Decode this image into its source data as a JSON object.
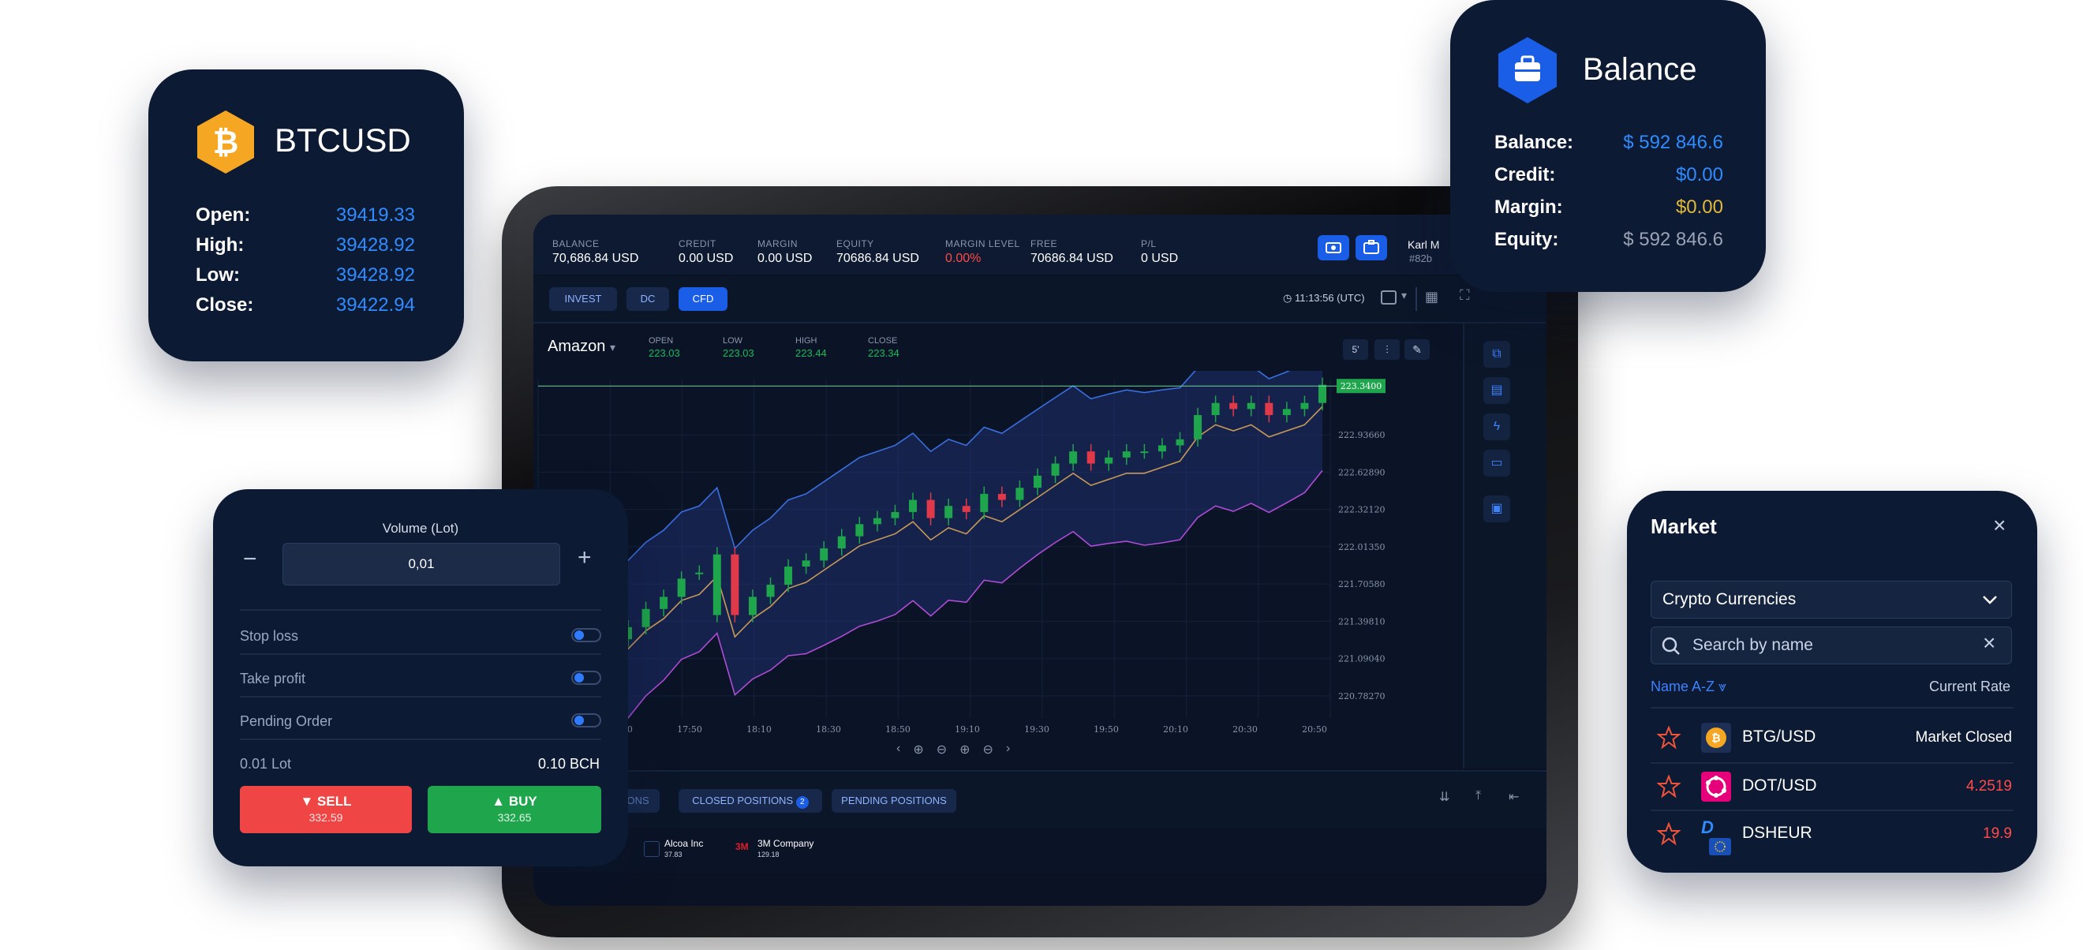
{
  "btc_card": {
    "symbol": "BTCUSD",
    "rows": [
      {
        "label": "Open:",
        "value": "39419.33"
      },
      {
        "label": "High:",
        "value": "39428.92"
      },
      {
        "label": "Low:",
        "value": "39428.92"
      },
      {
        "label": "Close:",
        "value": "39422.94"
      }
    ]
  },
  "balance_card": {
    "title": "Balance",
    "rows": [
      {
        "label": "Balance:",
        "value": "$ 592 846.6",
        "color": "#2f8cff"
      },
      {
        "label": "Credit:",
        "value": "$0.00",
        "color": "#2f8cff"
      },
      {
        "label": "Margin:",
        "value": "$0.00",
        "color": "#e2b93b"
      },
      {
        "label": "Equity:",
        "value": "$ 592 846.6",
        "color": "#9aa3b5"
      }
    ]
  },
  "topbar": {
    "stats": [
      {
        "label": "BALANCE",
        "value": "70,686.84 USD"
      },
      {
        "label": "CREDIT",
        "value": "0.00 USD"
      },
      {
        "label": "MARGIN",
        "value": "0.00 USD"
      },
      {
        "label": "EQUITY",
        "value": "70686.84 USD"
      },
      {
        "label": "MARGIN LEVEL",
        "value": "0.00%"
      },
      {
        "label": "FREE",
        "value": "70686.84 USD"
      },
      {
        "label": "P/L",
        "value": "0 USD"
      }
    ],
    "user_name": "Karl M",
    "user_id": "#82b"
  },
  "mode_tabs": [
    "INVEST",
    "DC",
    "CFD"
  ],
  "clock": "11:13:56 (UTC)",
  "chart_header": {
    "instrument": "Amazon",
    "ohlc": [
      {
        "label": "OPEN",
        "value": "223.03"
      },
      {
        "label": "LOW",
        "value": "223.03"
      },
      {
        "label": "HIGH",
        "value": "223.44"
      },
      {
        "label": "CLOSE",
        "value": "223.34"
      }
    ],
    "timeframe": "5'"
  },
  "chart_data": {
    "type": "candlestick",
    "y_ticks": [
      "222.93660",
      "222.62890",
      "222.32120",
      "222.01350",
      "221.70580",
      "221.39810",
      "221.09040",
      "220.78270"
    ],
    "x_ticks": [
      "17:30",
      "17:50",
      "18:10",
      "18:30",
      "18:50",
      "19:10",
      "19:30",
      "19:50",
      "20:10",
      "20:30",
      "20:50"
    ],
    "current_price": "223.3400",
    "candle_closes": [
      221.35,
      221.5,
      221.6,
      221.75,
      221.8,
      221.95,
      221.45,
      221.6,
      221.7,
      221.85,
      221.9,
      222.0,
      222.1,
      222.2,
      222.25,
      222.3,
      222.4,
      222.25,
      222.35,
      222.3,
      222.45,
      222.4,
      222.5,
      222.6,
      222.7,
      222.8,
      222.7,
      222.75,
      222.8,
      222.8,
      222.85,
      222.9,
      223.1,
      223.2,
      223.15,
      223.2,
      223.1,
      223.15,
      223.2,
      223.35
    ],
    "candle_opens": [
      221.25,
      221.35,
      221.5,
      221.6,
      221.8,
      221.45,
      221.95,
      221.45,
      221.6,
      221.7,
      221.85,
      221.9,
      222.0,
      222.1,
      222.2,
      222.25,
      222.3,
      222.4,
      222.25,
      222.35,
      222.3,
      222.45,
      222.4,
      222.5,
      222.6,
      222.7,
      222.8,
      222.7,
      222.75,
      222.8,
      222.8,
      222.85,
      222.9,
      223.1,
      223.2,
      223.15,
      223.2,
      223.1,
      223.15,
      223.2
    ]
  },
  "positions_tabs": {
    "closed_label": "CLOSED POSITIONS",
    "closed_count": "2",
    "pending_label": "PENDING POSITIONS",
    "open_label": "ITIONS"
  },
  "bottom_tickers": [
    {
      "name": "Alcoa Inc",
      "price": "37.83"
    },
    {
      "name": "3M Company",
      "price": "129.18"
    }
  ],
  "order_card": {
    "volume_label": "Volume (Lot)",
    "volume_value": "0,01",
    "options": [
      "Stop loss",
      "Take profit",
      "Pending Order"
    ],
    "lot_left": "0.01 Lot",
    "lot_right": "0.10 BCH",
    "sell_label": "SELL",
    "sell_price": "332.59",
    "buy_label": "BUY",
    "buy_price": "332.65"
  },
  "market_card": {
    "title": "Market",
    "category": "Crypto Currencies",
    "search_placeholder": "Search by name",
    "sort_label": "Name A-Z",
    "rate_header": "Current Rate",
    "items": [
      {
        "name": "BTG/USD",
        "rate": "Market Closed",
        "rate_color": "#ffffff",
        "icon": "btg-coin-icon"
      },
      {
        "name": "DOT/USD",
        "rate": "4.2519",
        "rate_color": "#ff4a4a",
        "icon": "dot-coin-icon"
      },
      {
        "name": "DSHEUR",
        "rate": "19.9",
        "rate_color": "#ff4a4a",
        "icon": "dash-coin-icon"
      }
    ]
  }
}
